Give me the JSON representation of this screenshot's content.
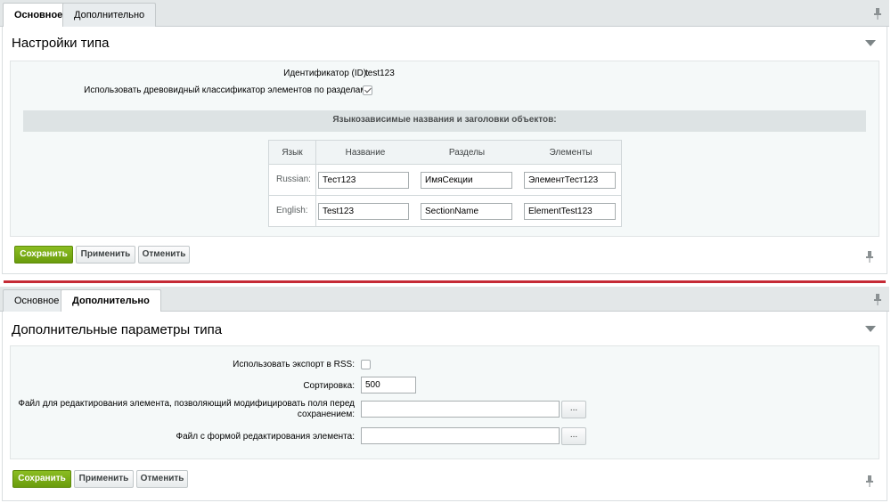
{
  "tabs": [
    {
      "label": "Основное"
    },
    {
      "label": "Дополнительно"
    }
  ],
  "main_section": {
    "title": "Настройки типа",
    "id_label": "Идентификатор (ID):",
    "id_value": "test123",
    "tree_label": "Использовать древовидный классификатор элементов по разделам:",
    "tree_checked": true,
    "lang_heading": "Языкозависимые названия и заголовки объектов:",
    "columns": [
      "Язык",
      "Название",
      "Разделы",
      "Элементы"
    ],
    "rows": [
      {
        "lang": "Russian:",
        "name": "Тест123",
        "sections": "ИмяСекции",
        "elements": "ЭлементТест123"
      },
      {
        "lang": "English:",
        "name": "Test123",
        "sections": "SectionName",
        "elements": "ElementTest123"
      }
    ]
  },
  "extra_section": {
    "title": "Дополнительные параметры типа",
    "rss_label": "Использовать экспорт в RSS:",
    "rss_checked": false,
    "sort_label": "Сортировка:",
    "sort_value": "500",
    "edit_file_label_line1": "Файл для редактирования элемента, позволяющий модифицировать поля перед",
    "edit_file_label_line2": "сохранением:",
    "edit_file_value": "",
    "form_file_label": "Файл с формой редактирования элемента:",
    "form_file_value": "",
    "browse_label": "..."
  },
  "buttons": {
    "save": "Сохранить",
    "apply": "Применить",
    "cancel": "Отменить"
  },
  "colors": {
    "save_button": "#76a716",
    "divider": "#c52a35",
    "tab_bar": "#e3e7e8"
  },
  "icons": {
    "pin": "pin-icon",
    "collapse": "chevron-down-icon"
  }
}
